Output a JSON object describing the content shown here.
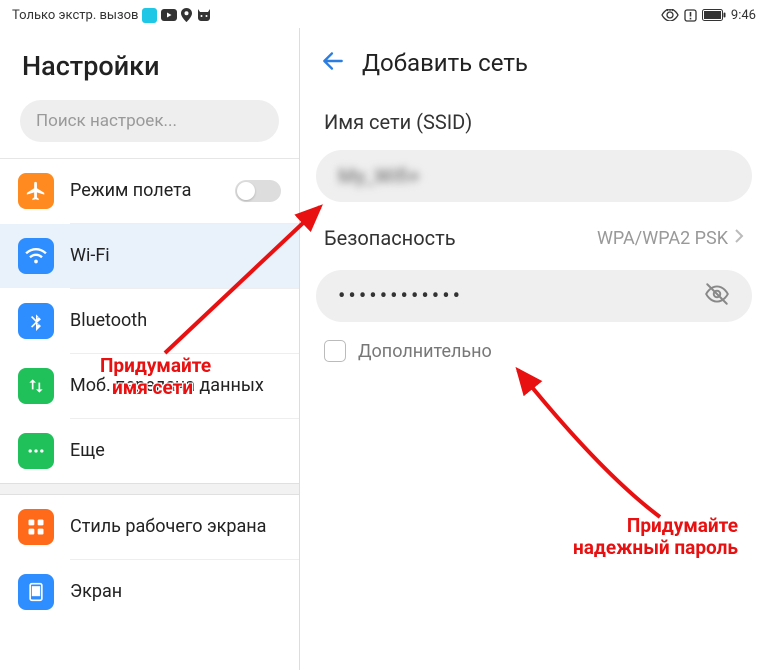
{
  "status": {
    "carrier": "Только экстр. вызов",
    "time": "9:46"
  },
  "left": {
    "title": "Настройки",
    "search_placeholder": "Поиск настроек...",
    "items": {
      "airplane": "Режим полета",
      "wifi": "Wi-Fi",
      "bluetooth": "Bluetooth",
      "mobile_data": "Моб. передача данных",
      "more": "Еще",
      "home_style": "Стиль рабочего экрана",
      "display": "Экран"
    }
  },
  "right": {
    "title": "Добавить сеть",
    "ssid_label": "Имя сети (SSID)",
    "ssid_blur": "My_Wifi+",
    "security_label": "Безопасность",
    "security_value": "WPA/WPA2 PSK",
    "password_masked": "••••••••••••",
    "advanced": "Дополнительно"
  },
  "annotations": {
    "a1_line1": "Придумайте",
    "a1_line2": "имя сети",
    "a2_line1": "Придумайте",
    "a2_line2": "надежный пароль"
  },
  "colors": {
    "airplane": "#ff8a1f",
    "wifi": "#2f8eff",
    "bluetooth": "#2f8eff",
    "mobile": "#20c05a",
    "more": "#20c05a",
    "home": "#ff6a1a",
    "display": "#2f8eff",
    "anno": "#e81010"
  }
}
